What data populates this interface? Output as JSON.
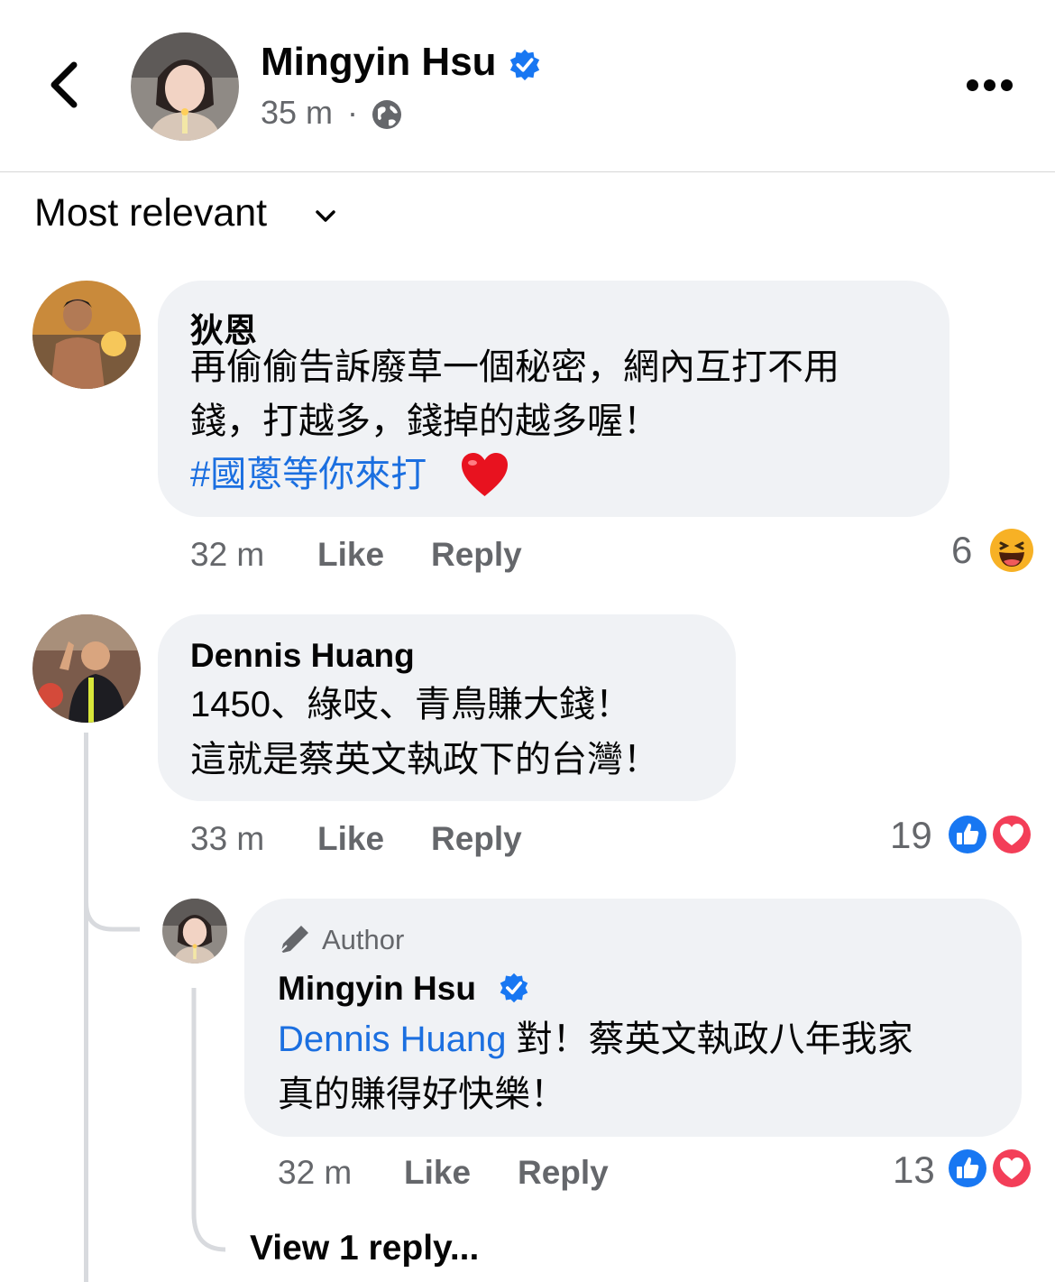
{
  "header": {
    "name": "Mingyin Hsu",
    "time": "35 m",
    "separator": "·",
    "icons": [
      "back-icon",
      "verified-icon",
      "globe-icon",
      "more-icon"
    ]
  },
  "sort": {
    "label": "Most relevant"
  },
  "comments": [
    {
      "name": "狄恩",
      "lines": [
        "再偷偷告訴廢草一個秘密，網內互打不用",
        "錢，打越多，錢掉的越多喔！"
      ],
      "hashtag": "#國蔥等你來打",
      "emoji": "❤️",
      "time": "32 m",
      "like": "Like",
      "reply": "Reply",
      "reaction_count": "6",
      "reactions": [
        "haha-icon"
      ]
    },
    {
      "name": "Dennis Huang",
      "lines": [
        "1450、綠吱、青鳥賺大錢！",
        "這就是蔡英文執政下的台灣！"
      ],
      "time": "33 m",
      "like": "Like",
      "reply": "Reply",
      "reaction_count": "19",
      "reactions": [
        "like-icon",
        "love-icon"
      ]
    }
  ],
  "reply": {
    "badge": "Author",
    "name": "Mingyin Hsu",
    "mention": "Dennis Huang",
    "line1": " 對！蔡英文執政八年我家",
    "line2": "真的賺得好快樂！",
    "time": "32 m",
    "like": "Like",
    "reply": "Reply",
    "reaction_count": "13",
    "reactions": [
      "like-icon",
      "love-icon"
    ]
  },
  "view_replies": "View 1 reply...",
  "colors": {
    "accent": "#1b6fe0",
    "verified": "#1877f2",
    "bubble": "#f0f2f5",
    "muted": "#65676b"
  }
}
